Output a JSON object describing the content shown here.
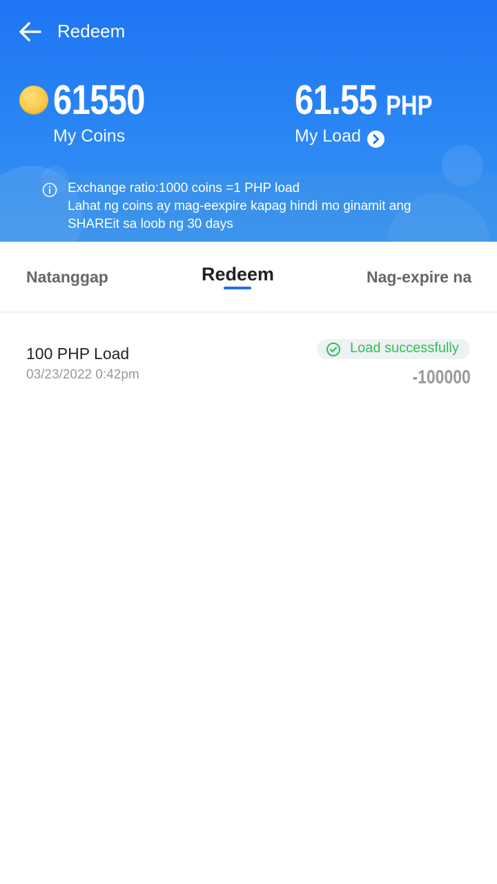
{
  "header": {
    "title": "Redeem",
    "coins": {
      "value": "61550",
      "label": "My Coins"
    },
    "load": {
      "value": "61.55",
      "unit": "PHP",
      "label": "My Load"
    },
    "notice": [
      "Exchange ratio:1000 coins =1 PHP load",
      "Lahat ng coins ay mag-eexpire kapag hindi mo ginamit ang",
      "SHAREit sa loob ng 30 days"
    ]
  },
  "tabs": [
    {
      "label": "Natanggap",
      "active": false
    },
    {
      "label": "Redeem",
      "active": true
    },
    {
      "label": "Nag-expire na",
      "active": false
    }
  ],
  "records": [
    {
      "name": "100 PHP Load",
      "date": "03/23/2022 0:42pm",
      "status": "Load successfully",
      "amount": "-100000"
    }
  ],
  "icons": {
    "back": "back-arrow-icon",
    "coin": "coin-icon",
    "chevron": "chevron-right-circle-icon",
    "info": "info-icon",
    "status": "check-circle-icon"
  },
  "colors": {
    "header_top": "#1e75f5",
    "header_bottom": "#3a95f0",
    "active_tab_indicator": "#1e6ff0",
    "success": "#2fbf58",
    "coin": "#fbc84a"
  }
}
